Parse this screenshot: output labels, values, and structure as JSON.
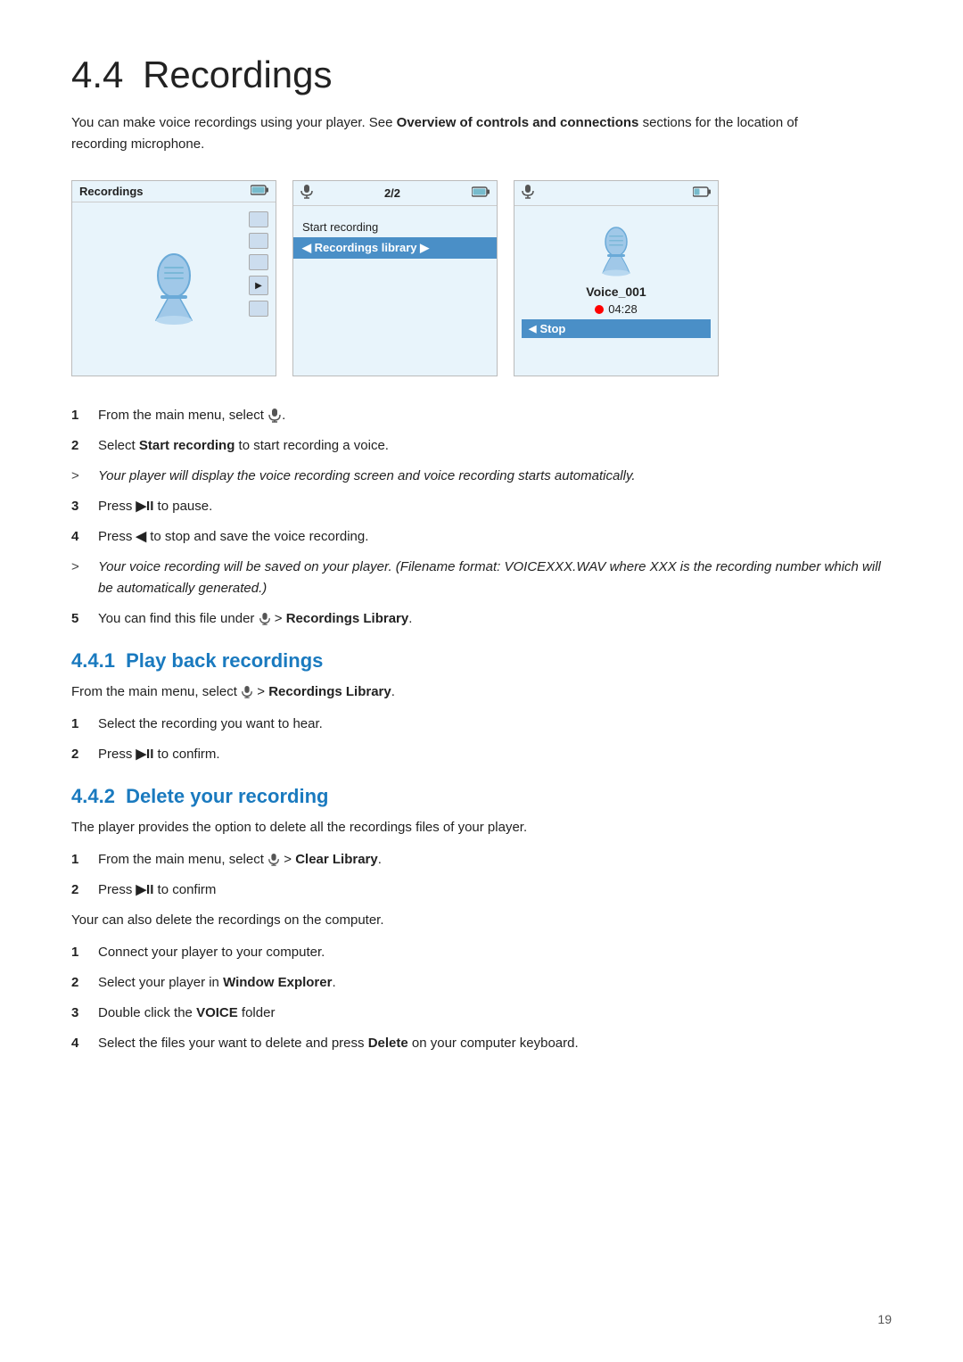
{
  "page": {
    "number": "19"
  },
  "main_title": {
    "section": "4.4",
    "title": "Recordings"
  },
  "intro": {
    "text_start": "You can make voice recordings using your player. See ",
    "bold_text": "Overview of controls and connections",
    "text_end": " sections for the location of recording microphone."
  },
  "screenshots": {
    "screen1": {
      "header_label": "Recordings",
      "aria": "Recordings main screen"
    },
    "screen2": {
      "header_label": "2/2",
      "menu_items": [
        {
          "label": "Start recording",
          "highlighted": false
        },
        {
          "label": "Recordings library",
          "highlighted": true
        }
      ],
      "aria": "Recording menu screen"
    },
    "screen3": {
      "header_label": "",
      "voice_name": "Voice_001",
      "time": "04:28",
      "stop_label": "Stop",
      "aria": "Recording in progress screen"
    }
  },
  "steps": [
    {
      "num": "1",
      "type": "num",
      "text_start": "From the main menu, select ",
      "bold": "",
      "text_end": "."
    },
    {
      "num": "2",
      "type": "num",
      "text_start": "Select ",
      "bold": "Start recording",
      "text_end": " to start recording a voice."
    },
    {
      "num": ">",
      "type": "gt",
      "text_start": "",
      "italic": "Your player will display the voice recording screen and voice recording starts automatically.",
      "text_end": ""
    },
    {
      "num": "3",
      "type": "num",
      "text_start": "Press ",
      "symbol": "▶II",
      "text_end": " to pause."
    },
    {
      "num": "4",
      "type": "num",
      "text_start": "Press ",
      "symbol": "◀",
      "text_end": " to stop and save the voice recording."
    },
    {
      "num": ">",
      "type": "gt",
      "text_start": "",
      "italic": "Your voice recording will be saved on your player. (Filename format: VOICEXXX.WAV where XXX is the recording number which will be automatically generated.)",
      "text_end": ""
    },
    {
      "num": "5",
      "type": "num",
      "text_start": "You can find this file under ",
      "bold": "Recordings Library",
      "text_end": "."
    }
  ],
  "subsection_441": {
    "num": "4.4.1",
    "title": "Play back recordings",
    "intro_start": "From the main menu, select ",
    "intro_bold": "Recordings Library",
    "intro_end": ".",
    "steps": [
      {
        "num": "1",
        "text": "Select the recording you want to hear."
      },
      {
        "num": "2",
        "text_start": "Press ",
        "symbol": "▶II",
        "text_end": " to confirm."
      }
    ]
  },
  "subsection_442": {
    "num": "4.4.2",
    "title": "Delete your recording",
    "intro": "The player provides the option to delete all the recordings files of your player.",
    "steps_a": [
      {
        "num": "1",
        "text_start": "From the main menu, select ",
        "bold": "Clear Library",
        "text_end": "."
      },
      {
        "num": "2",
        "text_start": "Press ",
        "symbol": "▶II",
        "text_end": " to confirm"
      }
    ],
    "middle_text": "Your can also delete the recordings on the computer.",
    "steps_b": [
      {
        "num": "1",
        "text": "Connect your player to your computer."
      },
      {
        "num": "2",
        "text_start": "Select your player in ",
        "bold": "Window Explorer",
        "text_end": "."
      },
      {
        "num": "3",
        "text_start": "Double click the ",
        "bold": "VOICE",
        "text_end": " folder"
      },
      {
        "num": "4",
        "text_start": "Select the files your want to delete and press ",
        "bold": "Delete",
        "text_end": " on your computer keyboard."
      }
    ]
  }
}
